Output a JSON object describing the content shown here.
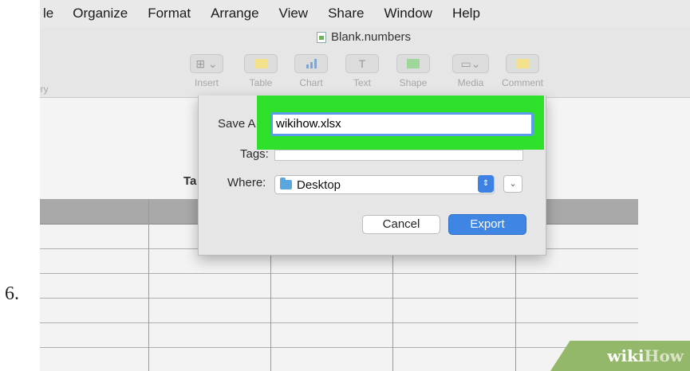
{
  "step_number": "6.",
  "menubar": {
    "items": [
      "le",
      "Organize",
      "Format",
      "Arrange",
      "View",
      "Share",
      "Window",
      "Help"
    ]
  },
  "window": {
    "title": "Blank.numbers"
  },
  "toolbar": {
    "left_label": "ory",
    "tools": [
      {
        "label": "Insert",
        "icon": "insert-icon"
      },
      {
        "label": "Table",
        "icon": "table-icon"
      },
      {
        "label": "Chart",
        "icon": "chart-icon"
      },
      {
        "label": "Text",
        "icon": "text-icon"
      },
      {
        "label": "Shape",
        "icon": "shape-icon"
      },
      {
        "label": "Media",
        "icon": "media-icon"
      },
      {
        "label": "Comment",
        "icon": "comment-icon"
      }
    ]
  },
  "canvas": {
    "sheet_title_fragment": "Ta"
  },
  "dialog": {
    "save_as_label": "Save A",
    "filename_value": "wikihow.xlsx",
    "tags_label": "Tags:",
    "tags_value": "",
    "where_label": "Where:",
    "where_value": "Desktop",
    "cancel_label": "Cancel",
    "export_label": "Export",
    "highlight_color": "#2ee02a",
    "accent_color": "#3f86e4"
  },
  "watermark": {
    "part1": "wiki",
    "part2": "How"
  }
}
